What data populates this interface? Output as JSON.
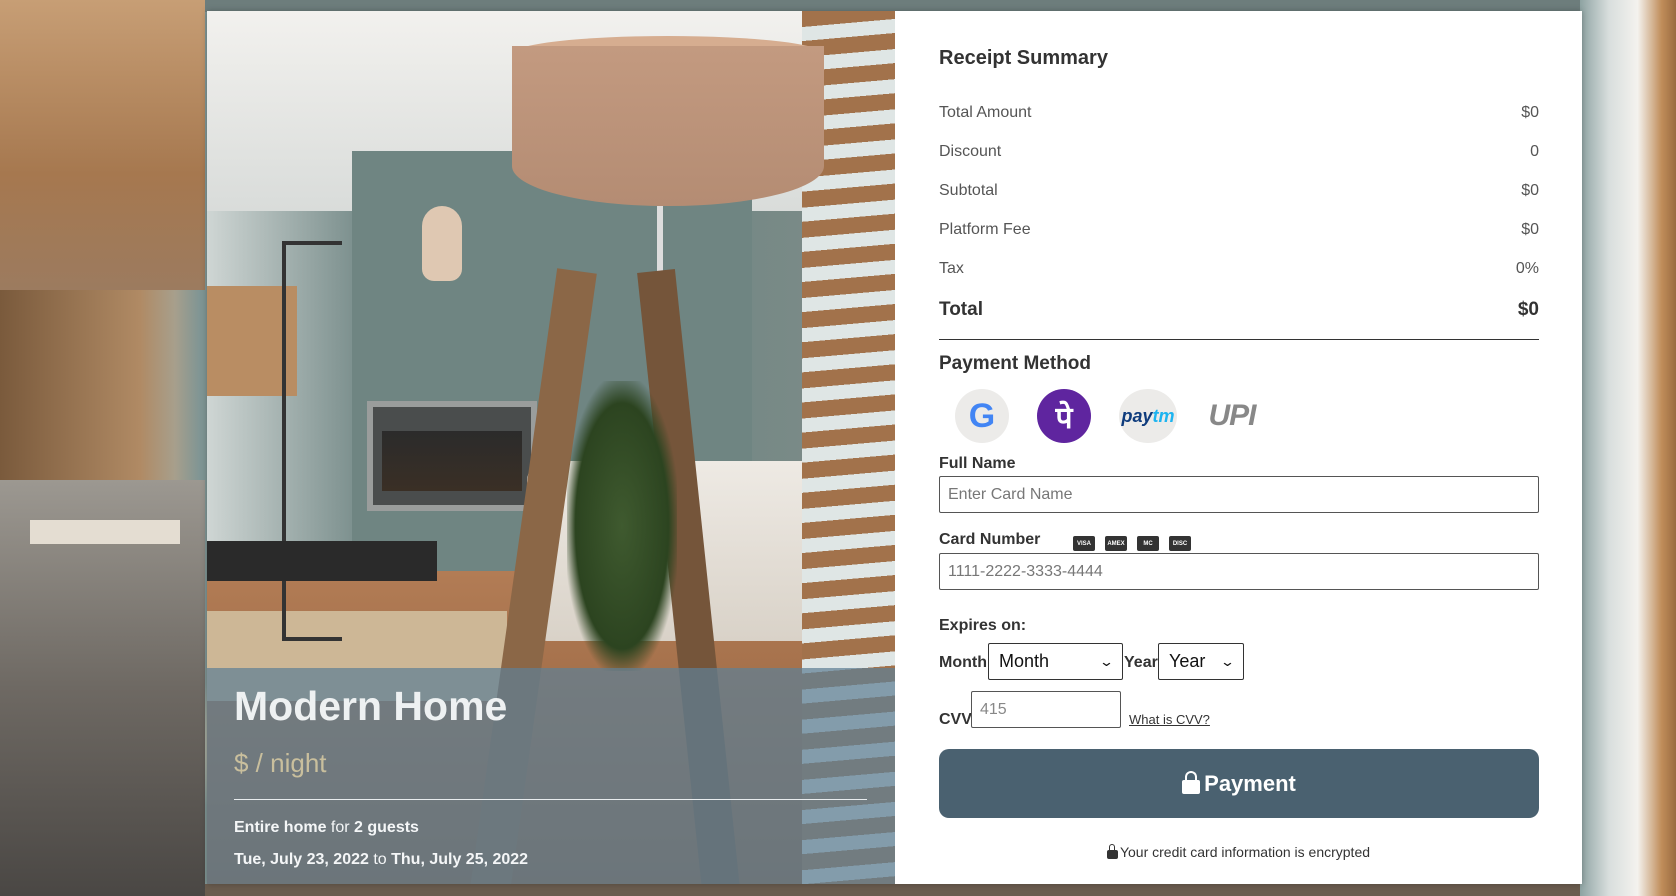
{
  "listing": {
    "title": "Modern Home",
    "price": "$ / night",
    "line1_bold1": "Entire home",
    "line1_mid": " for ",
    "line1_bold2": "2 guests",
    "check_in": "Tue, July 23, 2022",
    "date_sep": " to ",
    "check_out": "Thu, July 25, 2022"
  },
  "receipt": {
    "title": "Receipt Summary",
    "rows": [
      {
        "label": "Total Amount",
        "value": "$0"
      },
      {
        "label": "Discount",
        "value": "0"
      },
      {
        "label": "Subtotal",
        "value": "$0"
      },
      {
        "label": "Platform Fee",
        "value": "$0"
      },
      {
        "label": "Tax",
        "value": "0%"
      }
    ],
    "total_label": "Total",
    "total_value": "$0"
  },
  "payment": {
    "title": "Payment Method",
    "methods": {
      "google": "G",
      "phonepe": "पे",
      "paytm_a": "pay",
      "paytm_b": "tm",
      "upi": "UPI"
    },
    "icons": [
      "google-pay-icon",
      "phonepe-icon",
      "paytm-icon",
      "upi-icon"
    ]
  },
  "form": {
    "full_name_label": "Full Name",
    "full_name_placeholder": "Enter Card Name",
    "card_number_label": "Card Number",
    "card_brands": [
      "VISA",
      "AMEX",
      "MC",
      "DISC"
    ],
    "card_number_placeholder": "1111-2222-3333-4444",
    "expires_label": "Expires on:",
    "month_label": "Month",
    "month_selected": "Month",
    "year_label": "Year",
    "year_selected": "Year",
    "cvv_label": "CVV",
    "cvv_placeholder": "415",
    "cvv_help": "What is CVV?",
    "submit_label": "Payment",
    "secure_note": "Your credit card information is encrypted"
  },
  "colors": {
    "button": "#4a6170",
    "overlay": "#6080a0",
    "phonepe": "#5f259f"
  }
}
